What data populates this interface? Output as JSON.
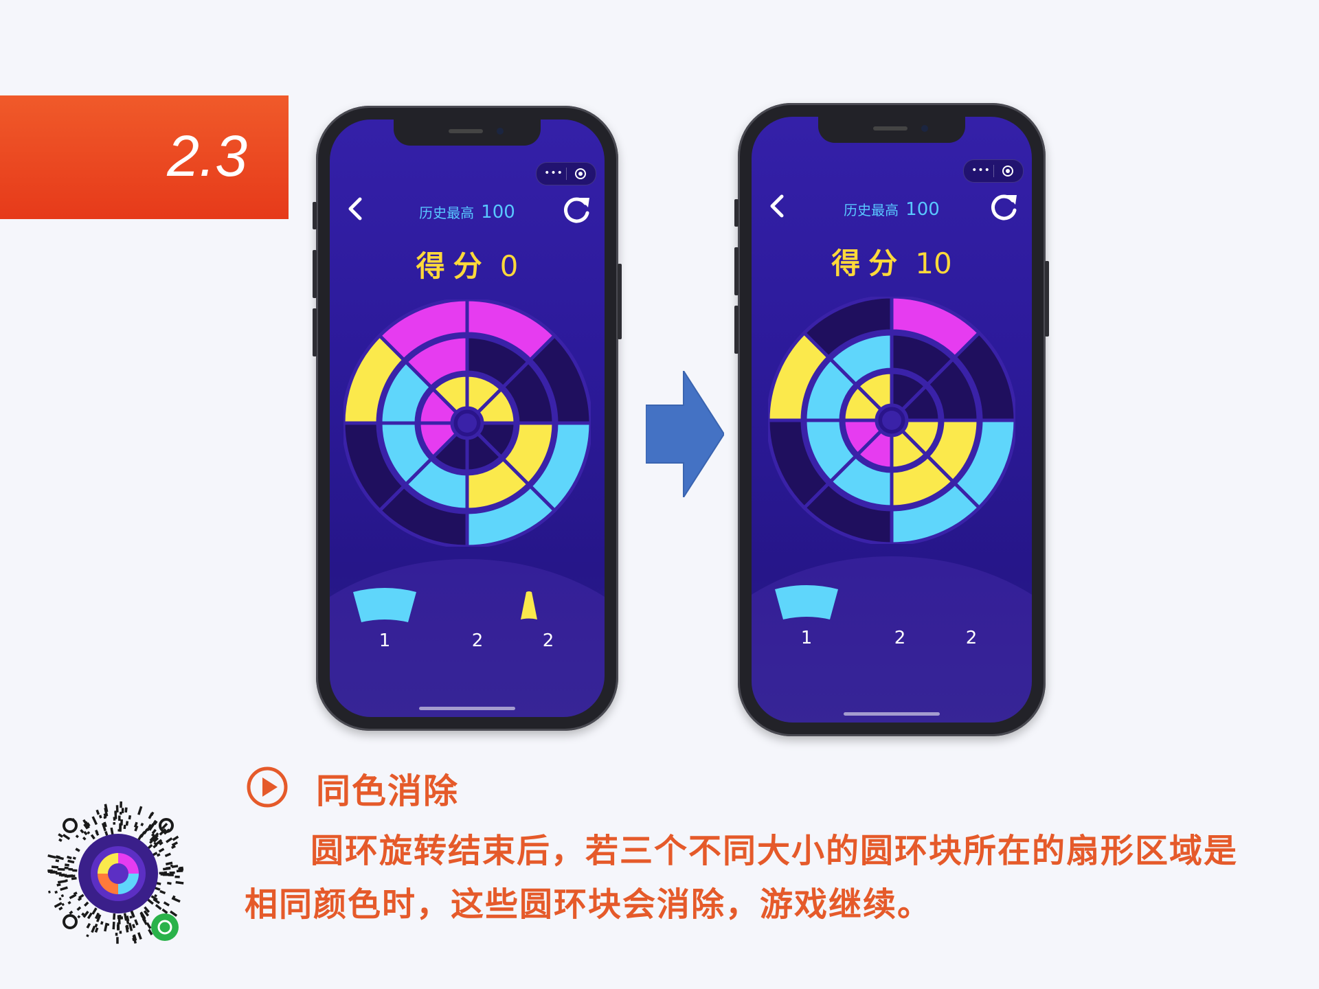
{
  "section": {
    "number": "2.3"
  },
  "phones": [
    {
      "best_label": "历史最高",
      "best_value": "100",
      "score_label": "得分",
      "score_value": "0",
      "counts": [
        "1",
        "2",
        "2"
      ]
    },
    {
      "best_label": "历史最高",
      "best_value": "100",
      "score_label": "得分",
      "score_value": "10",
      "counts": [
        "1",
        "2",
        "2"
      ]
    }
  ],
  "feature": {
    "title": "同色消除",
    "description": "圆环旋转结束后，若三个不同大小的圆环块所在的扇形区域是相同颜色时，这些圆环块会消除，游戏继续。"
  },
  "colors": {
    "accent": "#e55a2a",
    "badge": "#e8401c",
    "magenta": "#e63cf0",
    "yellow": "#fbe94c",
    "cyan": "#5fd6fb",
    "empty": "#1f0f5e",
    "arrow": "#4472c4"
  },
  "icons": [
    "back-icon",
    "refresh-icon",
    "more-icon",
    "target-icon",
    "play-icon",
    "arrow-right-icon",
    "qr-code-icon"
  ]
}
